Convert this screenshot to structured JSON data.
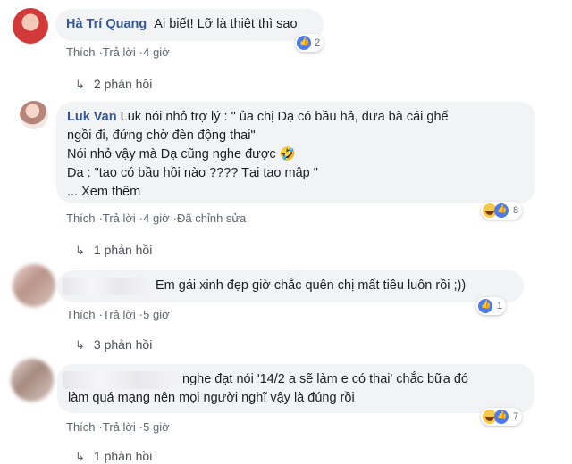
{
  "colors": {
    "link": "#365899",
    "bubble": "#f2f3f5",
    "like": "#4b7bec",
    "haha": "#f7c948"
  },
  "comments": [
    {
      "author": "Hà Trí Quang",
      "text": "Ai biết! Lỡ là thiệt thì sao",
      "actions": {
        "like": "Thích",
        "reply": "Trả lời",
        "time": "4 giờ"
      },
      "reaction_count": "2",
      "replies": "2 phản hồi"
    },
    {
      "author": "Luk Van",
      "line1": "Luk nói nhỏ trợ lý : \" ủa chị Dạ có bầu hả, đưa bà cái ghế",
      "line2": "ngồi đi, đứng chờ đèn động thai\"",
      "line3": "Nói nhỏ vậy mà Dạ cũng nghe được",
      "line4": "Dạ : \"tao có bầu hồi nào ???? Tại tao mập \"",
      "see_more": "... Xem thêm",
      "actions": {
        "like": "Thích",
        "reply": "Trả lời",
        "time": "4 giờ",
        "edited": "Đã chỉnh sửa"
      },
      "reaction_count": "8",
      "replies": "1 phản hồi"
    },
    {
      "text": "Em gái xinh đẹp giờ chắc quên chị mất tiêu luôn rồi ;))",
      "actions": {
        "like": "Thích",
        "reply": "Trả lời",
        "time": "5 giờ"
      },
      "reaction_count": "1",
      "replies": "3 phản hồi"
    },
    {
      "line1": "nghe đạt nói '14/2 a sẽ làm e có thai' chắc bữa đó",
      "line2": "làm quá mạng nên mọi người nghĩ vậy là đúng rồi",
      "actions": {
        "like": "Thích",
        "reply": "Trả lời",
        "time": "5 giờ"
      },
      "reaction_count": "7",
      "replies": "1 phản hồi"
    }
  ]
}
